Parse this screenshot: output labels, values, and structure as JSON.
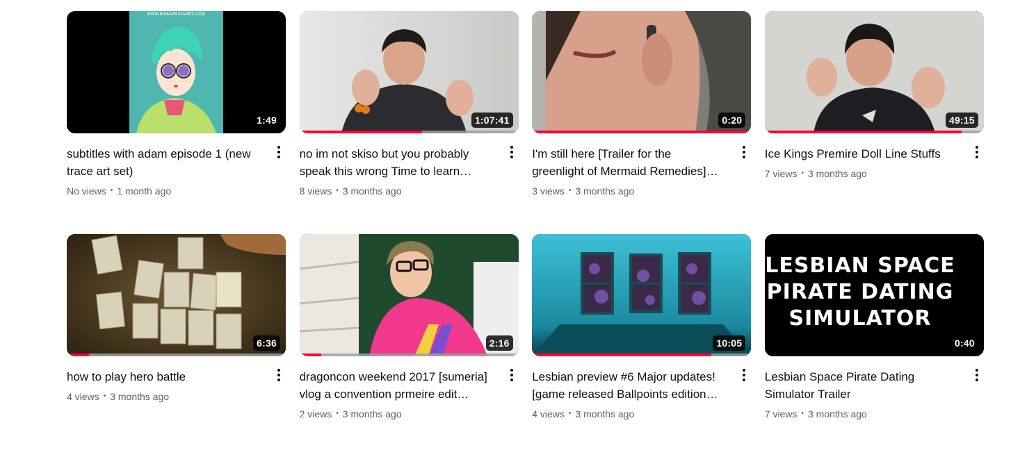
{
  "videos": [
    {
      "title": "subtitles with adam episode 1 (new trace art set)",
      "views": "No views",
      "age": "1 month ago",
      "duration": "1:49",
      "progress": 0,
      "thumb": "anime-boy"
    },
    {
      "title": "no im not skiso but you probably speak this wrong Time to learn…",
      "views": "8 views",
      "age": "3 months ago",
      "duration": "1:07:41",
      "progress": 0.56,
      "thumb": "person-waving"
    },
    {
      "title": "I'm still here [Trailer for the greenlight of Mermaid Remedies]…",
      "views": "3 views",
      "age": "3 months ago",
      "duration": "0:20",
      "progress": 1,
      "thumb": "phone-call"
    },
    {
      "title": "Ice Kings Premire Doll Line Stuffs",
      "views": "7 views",
      "age": "3 months ago",
      "duration": "49:15",
      "progress": 0.9,
      "thumb": "person-waving-2"
    },
    {
      "title": "how to play hero battle",
      "views": "4 views",
      "age": "3 months ago",
      "duration": "6:36",
      "progress": 0.1,
      "thumb": "cards"
    },
    {
      "title": "dragoncon weekend 2017 [sumeria] vlog a convention prmeire edit…",
      "views": "2 views",
      "age": "3 months ago",
      "duration": "2:16",
      "progress": 0.1,
      "thumb": "pink-sweater"
    },
    {
      "title": "Lesbian preview #6 Major updates! [game released Ballpoints edition…",
      "views": "4 views",
      "age": "3 months ago",
      "duration": "10:05",
      "progress": 0.82,
      "thumb": "blue-room"
    },
    {
      "title": "Lesbian Space Pirate Dating Simulator Trailer",
      "views": "7 views",
      "age": "3 months ago",
      "duration": "0:40",
      "progress": 0,
      "thumb": "text-title",
      "thumb_text": [
        "LESBIAN SPACE",
        "PIRATE DATING",
        "SIMULATOR"
      ]
    }
  ],
  "watermark": "WWW.RINMARUGAMES.COM",
  "colors": {
    "progress": "#ff0033",
    "track": "#a0a0a0",
    "meta": "#606060",
    "text": "#0f0f0f"
  }
}
